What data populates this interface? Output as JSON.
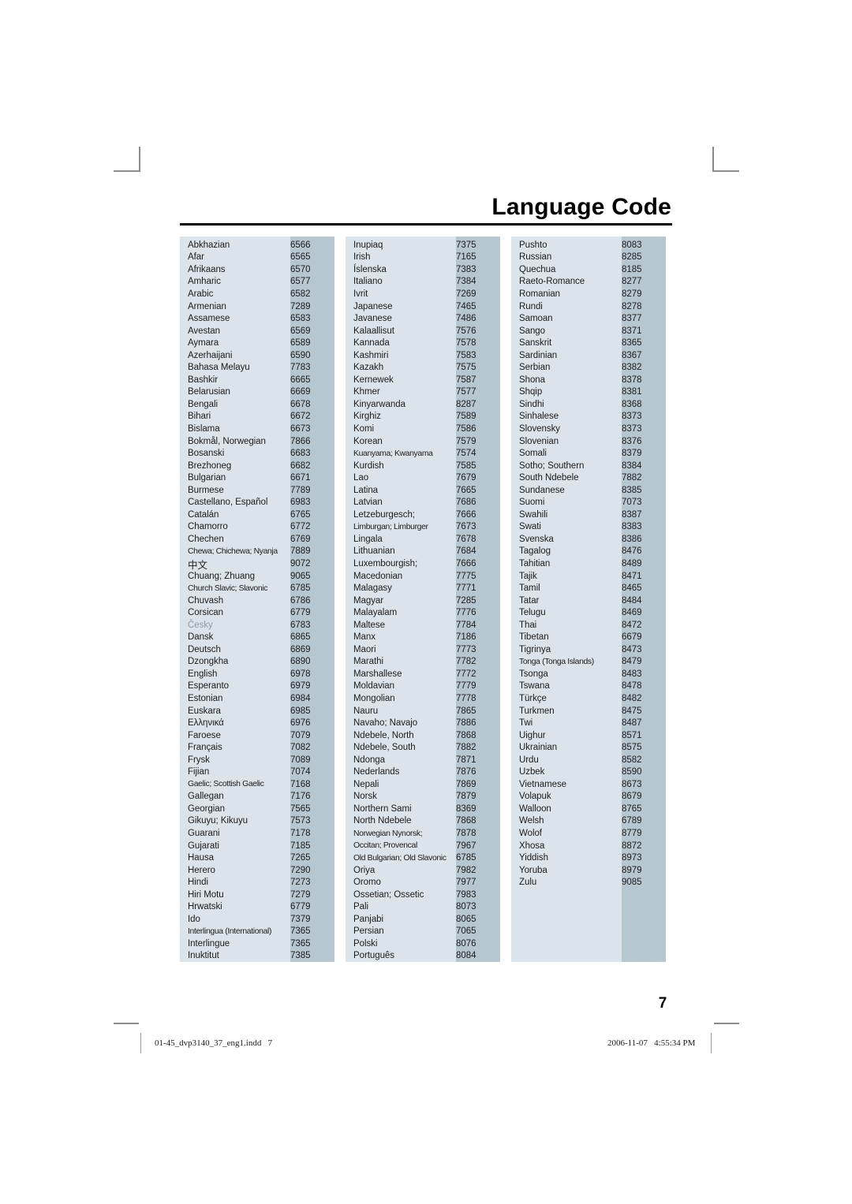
{
  "document": {
    "page_title": "Language Code",
    "page_number": "7",
    "footer_left": "01-45_dvp3140_37_eng1.indd   7",
    "footer_right": "2006-11-07   4:55:34 PM"
  },
  "colors": {
    "panel_background": "#dbe4ea",
    "code_column_background": "#b7c7d1",
    "text": "#1b1b1b",
    "rule": "#000000",
    "crop_mark": "#8c8c8c"
  },
  "table": {
    "columns": [
      {
        "id": "column-1",
        "rows": [
          {
            "language": "Abkhazian",
            "code": "6566"
          },
          {
            "language": "Afar",
            "code": "6565"
          },
          {
            "language": "Afrikaans",
            "code": "6570"
          },
          {
            "language": "Amharic",
            "code": "6577"
          },
          {
            "language": "Arabic",
            "code": "6582"
          },
          {
            "language": "Armenian",
            "code": "7289"
          },
          {
            "language": "Assamese",
            "code": "6583"
          },
          {
            "language": "Avestan",
            "code": "6569"
          },
          {
            "language": "Aymara",
            "code": "6589"
          },
          {
            "language": "Azerhaijani",
            "code": "6590"
          },
          {
            "language": "Bahasa Melayu",
            "code": "7783"
          },
          {
            "language": "Bashkir",
            "code": "6665"
          },
          {
            "language": "Belarusian",
            "code": "6669"
          },
          {
            "language": "Bengali",
            "code": "6678"
          },
          {
            "language": "Bihari",
            "code": "6672"
          },
          {
            "language": "Bislama",
            "code": "6673"
          },
          {
            "language": "Bokmål, Norwegian",
            "code": "7866"
          },
          {
            "language": "Bosanski",
            "code": "6683"
          },
          {
            "language": "Brezhoneg",
            "code": "6682"
          },
          {
            "language": "Bulgarian",
            "code": "6671"
          },
          {
            "language": "Burmese",
            "code": "7789"
          },
          {
            "language": "Castellano, Español",
            "code": "6983"
          },
          {
            "language": "Catalán",
            "code": "6765"
          },
          {
            "language": "Chamorro",
            "code": "6772"
          },
          {
            "language": "Chechen",
            "code": "6769"
          },
          {
            "language": "Chewa; Chichewa; Nyanja",
            "code": "7889",
            "style": "tight"
          },
          {
            "language": "中文",
            "code": "9072",
            "style": "cjk"
          },
          {
            "language": "Chuang; Zhuang",
            "code": "9065"
          },
          {
            "language": "Church Slavic; Slavonic",
            "code": "6785",
            "style": "tight"
          },
          {
            "language": "Chuvash",
            "code": "6786"
          },
          {
            "language": "Corsican",
            "code": "6779"
          },
          {
            "language": "Česky",
            "code": "6783",
            "style": "faint"
          },
          {
            "language": "Dansk",
            "code": "6865"
          },
          {
            "language": "Deutsch",
            "code": "6869"
          },
          {
            "language": "Dzongkha",
            "code": "6890"
          },
          {
            "language": "English",
            "code": "6978"
          },
          {
            "language": "Esperanto",
            "code": "6979"
          },
          {
            "language": "Estonian",
            "code": "6984"
          },
          {
            "language": "Euskara",
            "code": "6985"
          },
          {
            "language": "Ελληνικά",
            "code": "6976"
          },
          {
            "language": "Faroese",
            "code": "7079"
          },
          {
            "language": "Français",
            "code": "7082"
          },
          {
            "language": "Frysk",
            "code": "7089"
          },
          {
            "language": "Fijian",
            "code": "7074"
          },
          {
            "language": "Gaelic; Scottish Gaelic",
            "code": "7168",
            "style": "tight"
          },
          {
            "language": "Gallegan",
            "code": "7176"
          },
          {
            "language": "Georgian",
            "code": "7565"
          },
          {
            "language": "Gikuyu; Kikuyu",
            "code": "7573"
          },
          {
            "language": "Guarani",
            "code": "7178"
          },
          {
            "language": "Gujarati",
            "code": "7185"
          },
          {
            "language": "Hausa",
            "code": "7265"
          },
          {
            "language": "Herero",
            "code": "7290"
          },
          {
            "language": "Hindi",
            "code": "7273"
          },
          {
            "language": "Hiri Motu",
            "code": "7279"
          },
          {
            "language": "Hrwatski",
            "code": "6779"
          },
          {
            "language": "Ido",
            "code": "7379"
          },
          {
            "language": "Interlingua (International)",
            "code": "7365",
            "style": "tight"
          },
          {
            "language": "Interlingue",
            "code": "7365"
          },
          {
            "language": "Inuktitut",
            "code": "7385"
          }
        ]
      },
      {
        "id": "column-2",
        "rows": [
          {
            "language": "Inupiaq",
            "code": "7375"
          },
          {
            "language": "Irish",
            "code": "7165"
          },
          {
            "language": "Íslenska",
            "code": "7383"
          },
          {
            "language": "Italiano",
            "code": "7384"
          },
          {
            "language": "Ivrit",
            "code": "7269"
          },
          {
            "language": "Japanese",
            "code": "7465"
          },
          {
            "language": "Javanese",
            "code": "7486"
          },
          {
            "language": "Kalaallisut",
            "code": "7576"
          },
          {
            "language": "Kannada",
            "code": "7578"
          },
          {
            "language": "Kashmiri",
            "code": "7583"
          },
          {
            "language": "Kazakh",
            "code": "7575"
          },
          {
            "language": "Kernewek",
            "code": "7587"
          },
          {
            "language": "Khmer",
            "code": "7577"
          },
          {
            "language": "Kinyarwanda",
            "code": "8287"
          },
          {
            "language": "Kirghiz",
            "code": "7589"
          },
          {
            "language": "Komi",
            "code": "7586"
          },
          {
            "language": "Korean",
            "code": "7579"
          },
          {
            "language": "Kuanyama; Kwanyama",
            "code": "7574",
            "style": "tight"
          },
          {
            "language": "Kurdish",
            "code": "7585"
          },
          {
            "language": "Lao",
            "code": "7679"
          },
          {
            "language": "Latina",
            "code": "7665"
          },
          {
            "language": "Latvian",
            "code": "7686"
          },
          {
            "language": "Letzeburgesch;",
            "code": "7666"
          },
          {
            "language": "Limburgan; Limburger",
            "code": "7673",
            "style": "tight"
          },
          {
            "language": "Lingala",
            "code": "7678"
          },
          {
            "language": "Lithuanian",
            "code": "7684"
          },
          {
            "language": "Luxembourgish;",
            "code": "7666"
          },
          {
            "language": "Macedonian",
            "code": "7775"
          },
          {
            "language": "Malagasy",
            "code": "7771"
          },
          {
            "language": "Magyar",
            "code": "7285"
          },
          {
            "language": "Malayalam",
            "code": "7776"
          },
          {
            "language": "Maltese",
            "code": "7784"
          },
          {
            "language": "Manx",
            "code": "7186"
          },
          {
            "language": "Maori",
            "code": "7773"
          },
          {
            "language": "Marathi",
            "code": "7782"
          },
          {
            "language": "Marshallese",
            "code": "7772"
          },
          {
            "language": "Moldavian",
            "code": "7779"
          },
          {
            "language": "Mongolian",
            "code": "7778"
          },
          {
            "language": "Nauru",
            "code": "7865"
          },
          {
            "language": "Navaho; Navajo",
            "code": "7886"
          },
          {
            "language": "Ndebele, North",
            "code": "7868"
          },
          {
            "language": "Ndebele, South",
            "code": "7882"
          },
          {
            "language": "Ndonga",
            "code": "7871"
          },
          {
            "language": "Nederlands",
            "code": "7876"
          },
          {
            "language": "Nepali",
            "code": "7869"
          },
          {
            "language": "Norsk",
            "code": "7879"
          },
          {
            "language": "Northern Sami",
            "code": "8369"
          },
          {
            "language": "North Ndebele",
            "code": "7868"
          },
          {
            "language": "Norwegian Nynorsk;",
            "code": "7878",
            "style": "tight"
          },
          {
            "language": "Occitan; Provencal",
            "code": "7967",
            "style": "tight"
          },
          {
            "language": "Old Bulgarian; Old Slavonic",
            "code": "6785",
            "style": "tight"
          },
          {
            "language": "Oriya",
            "code": "7982"
          },
          {
            "language": "Oromo",
            "code": "7977"
          },
          {
            "language": "Ossetian; Ossetic",
            "code": "7983"
          },
          {
            "language": "Pali",
            "code": "8073"
          },
          {
            "language": "Panjabi",
            "code": "8065"
          },
          {
            "language": "Persian",
            "code": "7065"
          },
          {
            "language": "Polski",
            "code": "8076"
          },
          {
            "language": "Português",
            "code": "8084"
          }
        ]
      },
      {
        "id": "column-3",
        "rows": [
          {
            "language": "Pushto",
            "code": "8083"
          },
          {
            "language": "Russian",
            "code": "8285"
          },
          {
            "language": "Quechua",
            "code": "8185"
          },
          {
            "language": "Raeto-Romance",
            "code": "8277"
          },
          {
            "language": "Romanian",
            "code": "8279"
          },
          {
            "language": "Rundi",
            "code": "8278"
          },
          {
            "language": "Samoan",
            "code": "8377"
          },
          {
            "language": "Sango",
            "code": "8371"
          },
          {
            "language": "Sanskrit",
            "code": "8365"
          },
          {
            "language": "Sardinian",
            "code": "8367"
          },
          {
            "language": "Serbian",
            "code": "8382"
          },
          {
            "language": "Shona",
            "code": "8378"
          },
          {
            "language": "Shqip",
            "code": "8381"
          },
          {
            "language": "Sindhi",
            "code": "8368"
          },
          {
            "language": "Sinhalese",
            "code": "8373"
          },
          {
            "language": "Slovensky",
            "code": "8373"
          },
          {
            "language": "Slovenian",
            "code": "8376"
          },
          {
            "language": "Somali",
            "code": "8379"
          },
          {
            "language": "Sotho; Southern",
            "code": "8384"
          },
          {
            "language": "South Ndebele",
            "code": "7882"
          },
          {
            "language": "Sundanese",
            "code": "8385"
          },
          {
            "language": "Suomi",
            "code": "7073"
          },
          {
            "language": "Swahili",
            "code": "8387"
          },
          {
            "language": "Swati",
            "code": "8383"
          },
          {
            "language": "Svenska",
            "code": "8386"
          },
          {
            "language": "Tagalog",
            "code": "8476"
          },
          {
            "language": "Tahitian",
            "code": "8489"
          },
          {
            "language": "Tajik",
            "code": "8471"
          },
          {
            "language": "Tamil",
            "code": "8465"
          },
          {
            "language": "Tatar",
            "code": "8484"
          },
          {
            "language": "Telugu",
            "code": "8469"
          },
          {
            "language": "Thai",
            "code": "8472"
          },
          {
            "language": "Tibetan",
            "code": "6679"
          },
          {
            "language": "Tigrinya",
            "code": "8473"
          },
          {
            "language": "Tonga (Tonga Islands)",
            "code": "8479",
            "style": "tight"
          },
          {
            "language": "Tsonga",
            "code": "8483"
          },
          {
            "language": "Tswana",
            "code": "8478"
          },
          {
            "language": "Türkçe",
            "code": "8482"
          },
          {
            "language": "Turkmen",
            "code": "8475"
          },
          {
            "language": "Twi",
            "code": "8487"
          },
          {
            "language": "Uighur",
            "code": "8571"
          },
          {
            "language": "Ukrainian",
            "code": "8575"
          },
          {
            "language": "Urdu",
            "code": "8582"
          },
          {
            "language": "Uzbek",
            "code": "8590"
          },
          {
            "language": "Vietnamese",
            "code": "8673"
          },
          {
            "language": "Volapuk",
            "code": "8679"
          },
          {
            "language": "Walloon",
            "code": "8765"
          },
          {
            "language": "Welsh",
            "code": "6789"
          },
          {
            "language": "Wolof",
            "code": "8779"
          },
          {
            "language": "Xhosa",
            "code": "8872"
          },
          {
            "language": "Yiddish",
            "code": "8973"
          },
          {
            "language": "Yoruba",
            "code": "8979"
          },
          {
            "language": "Zulu",
            "code": "9085"
          }
        ]
      }
    ]
  }
}
